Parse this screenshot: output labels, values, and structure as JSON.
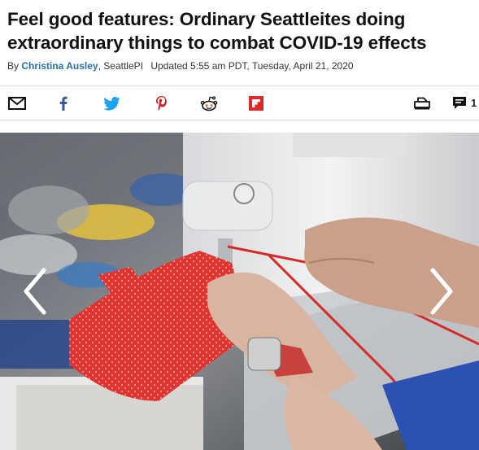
{
  "article": {
    "headline": "Feel good features: Ordinary Seattleites doing extraordinary things to combat COVID-19 effects",
    "byline_prefix": "By ",
    "author": "Christina Ausley",
    "publication": ", SeattlePI",
    "updated": "Updated 5:55 am PDT, Tuesday, April 21, 2020"
  },
  "share_bar": {
    "icons": [
      "email-icon",
      "facebook-icon",
      "twitter-icon",
      "pinterest-icon",
      "reddit-icon",
      "flipboard-icon",
      "print-icon",
      "comment-icon"
    ],
    "comment_count": "1"
  },
  "gallery": {
    "prev_icon": "chevron-left-icon",
    "next_icon": "chevron-right-icon",
    "image_subject": "hands sewing a red polka-dot face mask on a sewing machine"
  },
  "colors": {
    "author_link": "#2a6da8",
    "facebook": "#3b5998",
    "twitter": "#1da1f2",
    "pinterest": "#cb2027",
    "reddit": "#ff4500",
    "flipboard": "#e12828"
  }
}
